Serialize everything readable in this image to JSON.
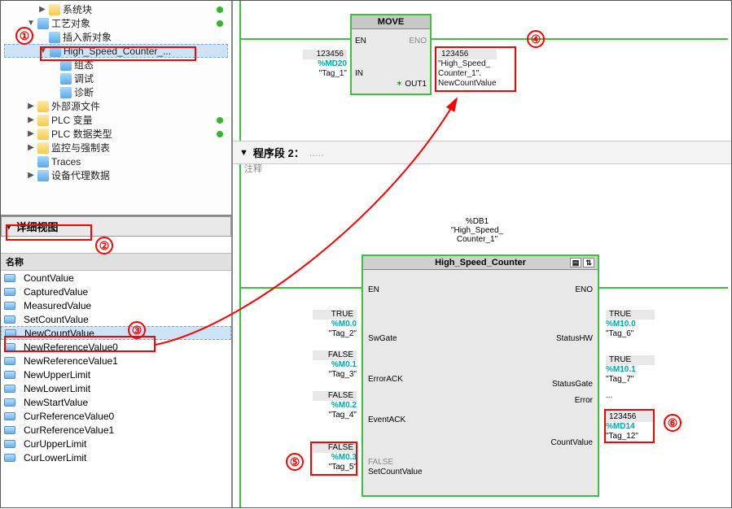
{
  "tree": {
    "items": [
      {
        "indent": 3,
        "exp": "▶",
        "icon": "folder",
        "label": "系统块",
        "dot": true
      },
      {
        "indent": 2,
        "exp": "▼",
        "icon": "obj",
        "label": "工艺对象",
        "dot": true
      },
      {
        "indent": 3,
        "exp": "",
        "icon": "obj",
        "label": "插入新对象",
        "dot": false
      },
      {
        "indent": 3,
        "exp": "▼",
        "icon": "obj",
        "label": "High_Speed_Counter_...",
        "dot": false,
        "sel": true
      },
      {
        "indent": 4,
        "exp": "",
        "icon": "obj",
        "label": "组态",
        "dot": false
      },
      {
        "indent": 4,
        "exp": "",
        "icon": "obj",
        "label": "调试",
        "dot": false
      },
      {
        "indent": 4,
        "exp": "",
        "icon": "obj",
        "label": "诊断",
        "dot": false
      },
      {
        "indent": 2,
        "exp": "▶",
        "icon": "folder",
        "label": "外部源文件",
        "dot": false
      },
      {
        "indent": 2,
        "exp": "▶",
        "icon": "folder",
        "label": "PLC 变量",
        "dot": true
      },
      {
        "indent": 2,
        "exp": "▶",
        "icon": "folder",
        "label": "PLC 数据类型",
        "dot": true
      },
      {
        "indent": 2,
        "exp": "▶",
        "icon": "folder",
        "label": "监控与强制表",
        "dot": false
      },
      {
        "indent": 2,
        "exp": "",
        "icon": "obj",
        "label": "Traces",
        "dot": false
      },
      {
        "indent": 2,
        "exp": "▶",
        "icon": "obj",
        "label": "设备代理数据",
        "dot": false
      }
    ]
  },
  "detail": {
    "title": "详细视图",
    "col": "名称",
    "rows": [
      "CountValue",
      "CapturedValue",
      "MeasuredValue",
      "SetCountValue",
      "NewCountValue",
      "NewReferenceValue0",
      "NewReferenceValue1",
      "NewUpperLimit",
      "NewLowerLimit",
      "NewStartValue",
      "CurReferenceValue0",
      "CurReferenceValue1",
      "CurUpperLimit",
      "CurLowerLimit"
    ]
  },
  "move": {
    "title": "MOVE",
    "pins": {
      "en": "EN",
      "eno": "ENO",
      "in": "IN",
      "out1": "OUT1"
    },
    "in": {
      "val": "123456",
      "adr": "%MD20",
      "tag": "\"Tag_1\""
    },
    "out": {
      "val": "123456",
      "l1": "\"High_Speed_",
      "l2": "Counter_1\".",
      "l3": "NewCountValue"
    }
  },
  "seg2": {
    "label": "程序段 2：",
    "dots": ".....",
    "comment": "注释"
  },
  "hsc": {
    "db": "%DB1",
    "name1": "\"High_Speed_",
    "name2": "Counter_1\"",
    "title": "High_Speed_Counter",
    "left": [
      {
        "pin": "EN"
      },
      {
        "pin": "SwGate",
        "sig": "TRUE",
        "adr": "%M0.0",
        "tag": "\"Tag_2\""
      },
      {
        "pin": "ErrorACK",
        "sig": "FALSE",
        "adr": "%M0.1",
        "tag": "\"Tag_3\""
      },
      {
        "pin": "EventACK",
        "sig": "FALSE",
        "adr": "%M0.2",
        "tag": "\"Tag_4\""
      },
      {
        "pin": "SetCountValue",
        "sig": "FALSE",
        "adr": "%M0.3",
        "tag": "\"Tag_5\"",
        "inner": "FALSE"
      }
    ],
    "right": [
      {
        "pin": "ENO"
      },
      {
        "pin": "StatusHW",
        "sig": "TRUE",
        "adr": "%M10.0",
        "tag": "\"Tag_6\""
      },
      {
        "pin": "StatusGate",
        "sig": "TRUE",
        "adr": "%M10.1",
        "tag": "\"Tag_7\""
      },
      {
        "pin": "Error",
        "tag": "..."
      },
      {
        "pin": "CountValue",
        "val": "123456",
        "adr": "%MD14",
        "tag": "\"Tag_12\""
      }
    ]
  }
}
